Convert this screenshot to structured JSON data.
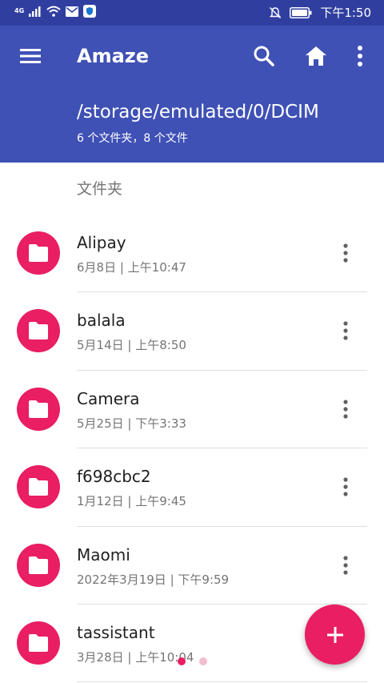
{
  "status_bar": {
    "network": "4G",
    "time": "下午1:50"
  },
  "app_bar": {
    "title": "Amaze",
    "path": "/storage/emulated/0/DCIM",
    "summary": "6 个文件夹，8 个文件"
  },
  "section": {
    "header": "文件夹"
  },
  "folders": [
    {
      "name": "Alipay",
      "meta": "6月8日 | 上午10:47"
    },
    {
      "name": "balala",
      "meta": "5月14日 | 上午8:50"
    },
    {
      "name": "Camera",
      "meta": "5月25日 | 下午3:33"
    },
    {
      "name": "f698cbc2",
      "meta": "1月12日 | 上午9:45"
    },
    {
      "name": "Maomi",
      "meta": "2022年3月19日 | 下午9:59"
    },
    {
      "name": "tassistant",
      "meta": "3月28日 | 上午10:04"
    }
  ],
  "colors": {
    "status_bar": "#303F9F",
    "app_bar": "#3F51B5",
    "accent": "#E91E63"
  },
  "icons": {
    "menu": "menu-icon",
    "search": "search-icon",
    "home": "home-icon",
    "more": "more-vert-icon",
    "folder": "folder-icon",
    "fab": "plus-icon"
  }
}
